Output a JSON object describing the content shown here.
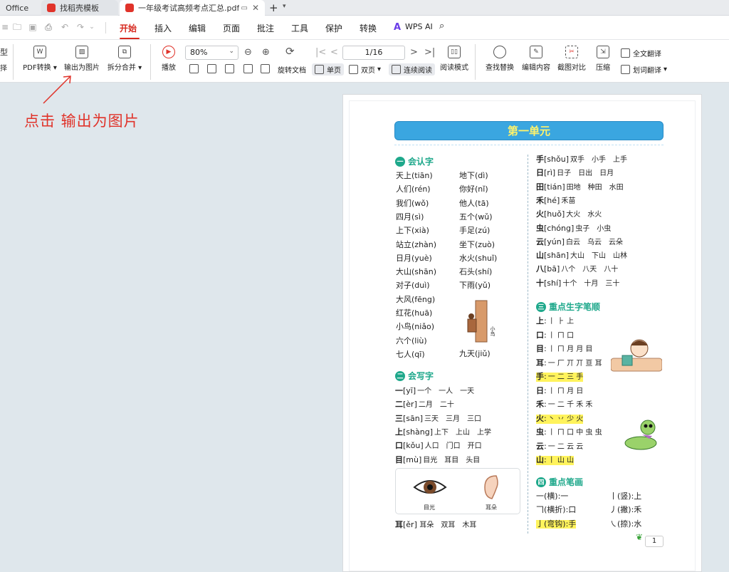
{
  "tabs": [
    {
      "label": "Office"
    },
    {
      "label": "找稻壳模板"
    },
    {
      "label": "一年级考试高频考点汇总.pdf"
    }
  ],
  "menu": [
    "开始",
    "插入",
    "编辑",
    "页面",
    "批注",
    "工具",
    "保护",
    "转换",
    "WPS AI"
  ],
  "ribbon": {
    "left_cut": [
      "型",
      "择"
    ],
    "pdf_convert": "PDF转换",
    "export_image": "输出为图片",
    "split_merge": "拆分合并",
    "play": "播放",
    "zoom": "80%",
    "rotate_doc": "旋转文档",
    "single_page": "单页",
    "double_page": "双页",
    "continuous": "连续阅读",
    "read_mode": "阅读模式",
    "page_indicator": "1/16",
    "find_replace": "查找替换",
    "edit_content": "编辑内容",
    "screenshot_compare": "截图对比",
    "compress": "压缩",
    "full_translate": "全文翻译",
    "word_translate": "划词翻译"
  },
  "annotation": "点击 输出为图片",
  "doc": {
    "banner": "第一单元",
    "sections": {
      "s1": {
        "num": "一",
        "title": "会认字"
      },
      "s2": {
        "num": "二",
        "title": "会写字"
      },
      "s3": {
        "num": "三",
        "title": "重点生字笔顺"
      },
      "s4": {
        "num": "四",
        "title": "重点笔画"
      }
    },
    "recognize_left": [
      "天上(tiān)",
      "人们(rén)",
      "我们(wǒ)",
      "四月(sì)",
      "上下(xià)",
      "站立(zhàn)",
      "日月(yuè)",
      "大山(shān)",
      "对子(duì)",
      "大风(fēng)",
      "红花(huā)",
      "小鸟(niǎo)",
      "六个(liù)",
      "七人(qī)"
    ],
    "recognize_right": [
      "地下(dì)",
      "你好(nǐ)",
      "他人(tā)",
      "五个(wǔ)",
      "手足(zú)",
      "坐下(zuò)",
      "水火(shuǐ)",
      "石头(shí)",
      "下雨(yǔ)",
      "九天(jiǔ)"
    ],
    "write_rows": [
      {
        "head": "一",
        "pinyin": "[yī]",
        "words": "一个　一人　一天"
      },
      {
        "head": "二",
        "pinyin": "[èr]",
        "words": "二月　二十"
      },
      {
        "head": "三",
        "pinyin": "[sān]",
        "words": "三天　三月　三口"
      },
      {
        "head": "上",
        "pinyin": "[shàng]",
        "words": "上下　上山　上学"
      },
      {
        "head": "口",
        "pinyin": "[kǒu]",
        "words": "人口　门口　开口"
      },
      {
        "head": "目",
        "pinyin": "[mù]",
        "words": "目光　耳目　头目"
      }
    ],
    "img_labels": [
      "目光",
      "耳朵"
    ],
    "tree_label": "小鸟",
    "er_row": {
      "head": "耳",
      "pinyin": "[ěr]",
      "words": "耳朵　双耳　木耳"
    },
    "right_rows": [
      {
        "head": "手",
        "pinyin": "[shǒu]",
        "words": "双手　小手　上手"
      },
      {
        "head": "日",
        "pinyin": "[rì]",
        "words": "日子　日出　日月"
      },
      {
        "head": "田",
        "pinyin": "[tián]",
        "words": "田地　种田　水田"
      },
      {
        "head": "禾",
        "pinyin": "[hé]",
        "words": "禾苗"
      },
      {
        "head": "火",
        "pinyin": "[huǒ]",
        "words": "大火　水火"
      },
      {
        "head": "虫",
        "pinyin": "[chóng]",
        "words": "虫子　小虫"
      },
      {
        "head": "云",
        "pinyin": "[yún]",
        "words": "白云　乌云　云朵"
      },
      {
        "head": "山",
        "pinyin": "[shān]",
        "words": "大山　下山　山林"
      },
      {
        "head": "八",
        "pinyin": "[bā]",
        "words": "八个　八天　八十"
      },
      {
        "head": "十",
        "pinyin": "[shí]",
        "words": "十个　十月　三十"
      }
    ],
    "stroke_rows": [
      {
        "head": "上",
        "strokes": "丨 ⺊ 上",
        "hl": false
      },
      {
        "head": "口",
        "strokes": "丨 ㄇ 口",
        "hl": false
      },
      {
        "head": "目",
        "strokes": "丨 ㄇ 月 月 目",
        "hl": false
      },
      {
        "head": "耳",
        "strokes": "一 厂 丌 丌 亘 耳",
        "hl": false
      },
      {
        "head": "手",
        "strokes": "一 二 三 手",
        "hl": true
      },
      {
        "head": "日",
        "strokes": "丨 ㄇ 月 日",
        "hl": false
      },
      {
        "head": "禾",
        "strokes": "一 二 千 禾 禾",
        "hl": false
      },
      {
        "head": "火",
        "strokes": "丶 丷 少 火",
        "hl": true
      },
      {
        "head": "虫",
        "strokes": "丨 ㄇ 口 中 虫 虫",
        "hl": false
      },
      {
        "head": "云",
        "strokes": "一 二 云 云",
        "hl": false
      },
      {
        "head": "山",
        "strokes": "丨 山 山",
        "hl": true
      }
    ],
    "key_strokes": [
      {
        "left": "一(横):一",
        "right": "丨(竖):上"
      },
      {
        "left": "𠃍(横折):口",
        "right": "丿(撇):禾"
      },
      {
        "left": "亅(弯钩):手",
        "right": "㇏(捺):水"
      }
    ],
    "page_number": "1"
  }
}
